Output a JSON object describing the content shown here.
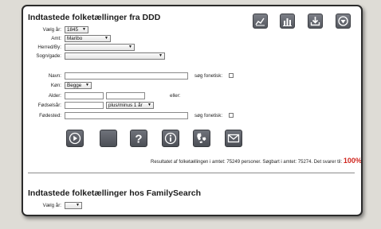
{
  "ddd": {
    "title": "Indtastede folketællinger fra DDD",
    "year_label": "Vælg år:",
    "year_value": "1845",
    "amt_label": "Amt:",
    "amt_value": "Maribo",
    "herred_label": "Herred/By:",
    "herred_value": "",
    "sogn_label": "Sogn/gade:",
    "sogn_value": "",
    "navn_label": "Navn:",
    "navn_value": "",
    "foneticsk_label": "søg fonetisk:",
    "koen_label": "Køn:",
    "koen_value": "Begge",
    "alder_label": "Alder:",
    "alder_from": "",
    "alder_to": "",
    "eller_label": "eller:",
    "faedselsaar_label": "Fødselsår:",
    "faedselsaar_value": "",
    "plusminus_value": "plus/minus 1 år",
    "faedested_label": "Fødested:",
    "faedested_value": "",
    "foneticsk2_label": "søg fonetisk:",
    "result_text": "Resultatet af folketællingen i amtet: 75249 personer. Søgbart i amtet: 75274. Det svarer til:",
    "result_pct": "100%"
  },
  "familysearch": {
    "title": "Indtastede folketællinger hos FamilySearch",
    "year_label": "Vælg år:",
    "year_value": ""
  },
  "icons": {
    "toolbar": [
      "line-chart-icon",
      "bar-chart-icon",
      "download-icon",
      "circle-down-arrow-icon"
    ],
    "bottom": [
      "play-icon",
      "blank-icon",
      "question-icon",
      "info-icon",
      "denmark-map-icon",
      "envelope-icon"
    ]
  },
  "colors": {
    "result_pct": "#d0241d",
    "icon_bg": "#5f626a",
    "panel_border": "#2b2b2b"
  }
}
